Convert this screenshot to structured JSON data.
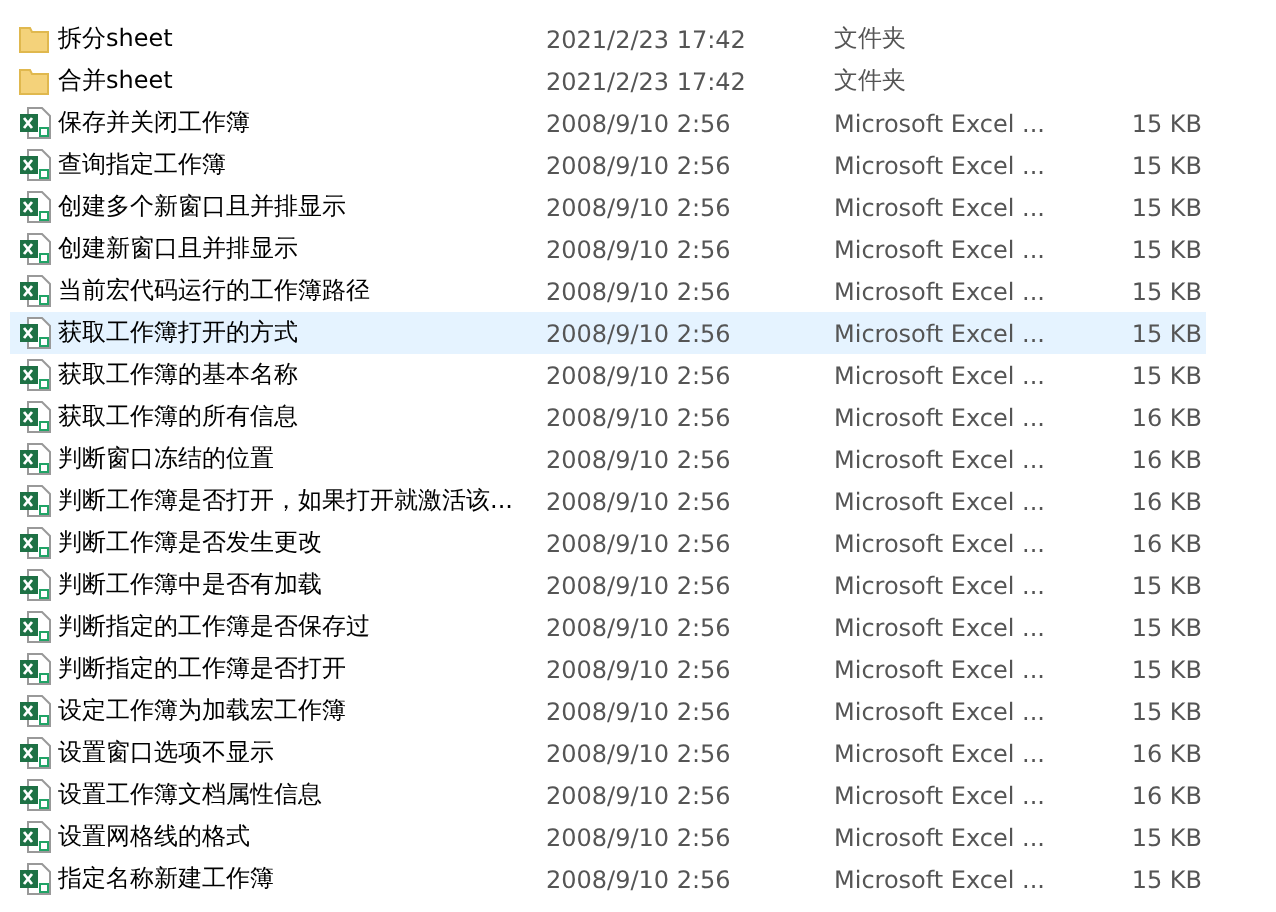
{
  "files": [
    {
      "kind": "folder",
      "name": "拆分sheet",
      "date": "2021/2/23 17:42",
      "type": "文件夹",
      "selected": false
    },
    {
      "kind": "folder",
      "name": "合并sheet",
      "date": "2021/2/23 17:42",
      "type": "文件夹",
      "selected": false
    },
    {
      "kind": "excel",
      "name": "保存并关闭工作簿",
      "date": "2008/9/10 2:56",
      "type": "Microsoft Excel ...",
      "size": "15 KB",
      "selected": false
    },
    {
      "kind": "excel",
      "name": "查询指定工作簿",
      "date": "2008/9/10 2:56",
      "type": "Microsoft Excel ...",
      "size": "15 KB",
      "selected": false
    },
    {
      "kind": "excel",
      "name": "创建多个新窗口且并排显示",
      "date": "2008/9/10 2:56",
      "type": "Microsoft Excel ...",
      "size": "15 KB",
      "selected": false
    },
    {
      "kind": "excel",
      "name": "创建新窗口且并排显示",
      "date": "2008/9/10 2:56",
      "type": "Microsoft Excel ...",
      "size": "15 KB",
      "selected": false
    },
    {
      "kind": "excel",
      "name": "当前宏代码运行的工作簿路径",
      "date": "2008/9/10 2:56",
      "type": "Microsoft Excel ...",
      "size": "15 KB",
      "selected": false
    },
    {
      "kind": "excel",
      "name": "获取工作簿打开的方式",
      "date": "2008/9/10 2:56",
      "type": "Microsoft Excel ...",
      "size": "15 KB",
      "selected": true
    },
    {
      "kind": "excel",
      "name": "获取工作簿的基本名称",
      "date": "2008/9/10 2:56",
      "type": "Microsoft Excel ...",
      "size": "15 KB",
      "selected": false
    },
    {
      "kind": "excel",
      "name": "获取工作簿的所有信息",
      "date": "2008/9/10 2:56",
      "type": "Microsoft Excel ...",
      "size": "16 KB",
      "selected": false
    },
    {
      "kind": "excel",
      "name": "判断窗口冻结的位置",
      "date": "2008/9/10 2:56",
      "type": "Microsoft Excel ...",
      "size": "16 KB",
      "selected": false
    },
    {
      "kind": "excel",
      "name": "判断工作簿是否打开，如果打开就激活该...",
      "date": "2008/9/10 2:56",
      "type": "Microsoft Excel ...",
      "size": "16 KB",
      "selected": false
    },
    {
      "kind": "excel",
      "name": "判断工作簿是否发生更改",
      "date": "2008/9/10 2:56",
      "type": "Microsoft Excel ...",
      "size": "16 KB",
      "selected": false
    },
    {
      "kind": "excel",
      "name": "判断工作簿中是否有加载",
      "date": "2008/9/10 2:56",
      "type": "Microsoft Excel ...",
      "size": "15 KB",
      "selected": false
    },
    {
      "kind": "excel",
      "name": "判断指定的工作簿是否保存过",
      "date": "2008/9/10 2:56",
      "type": "Microsoft Excel ...",
      "size": "15 KB",
      "selected": false
    },
    {
      "kind": "excel",
      "name": "判断指定的工作簿是否打开",
      "date": "2008/9/10 2:56",
      "type": "Microsoft Excel ...",
      "size": "15 KB",
      "selected": false
    },
    {
      "kind": "excel",
      "name": "设定工作簿为加载宏工作簿",
      "date": "2008/9/10 2:56",
      "type": "Microsoft Excel ...",
      "size": "15 KB",
      "selected": false
    },
    {
      "kind": "excel",
      "name": "设置窗口选项不显示",
      "date": "2008/9/10 2:56",
      "type": "Microsoft Excel ...",
      "size": "16 KB",
      "selected": false
    },
    {
      "kind": "excel",
      "name": "设置工作簿文档属性信息",
      "date": "2008/9/10 2:56",
      "type": "Microsoft Excel ...",
      "size": "16 KB",
      "selected": false
    },
    {
      "kind": "excel",
      "name": "设置网格线的格式",
      "date": "2008/9/10 2:56",
      "type": "Microsoft Excel ...",
      "size": "15 KB",
      "selected": false
    },
    {
      "kind": "excel",
      "name": "指定名称新建工作簿",
      "date": "2008/9/10 2:56",
      "type": "Microsoft Excel ...",
      "size": "15 KB",
      "selected": false
    }
  ]
}
